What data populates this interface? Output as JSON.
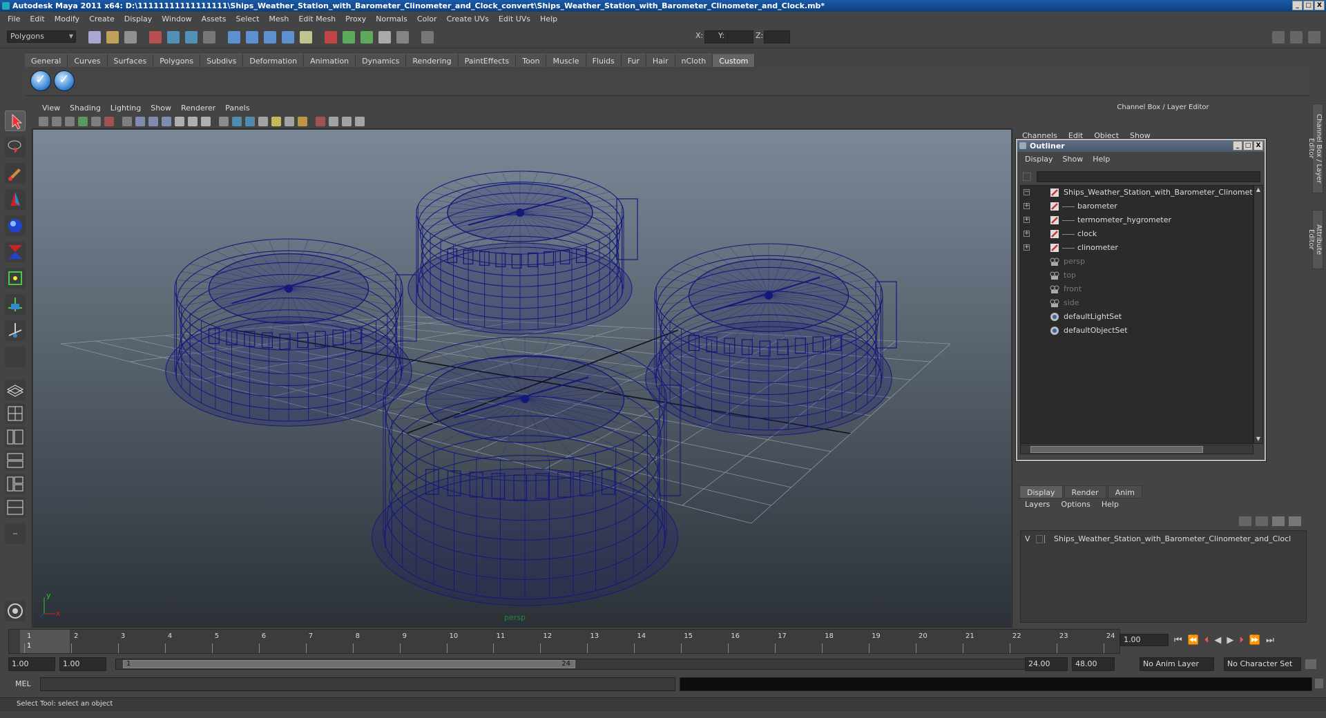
{
  "window": {
    "title": "Autodesk Maya 2011 x64: D:\\11111111111111111\\Ships_Weather_Station_with_Barometer_Clinometer_and_Clock_convert\\Ships_Weather_Station_with_Barometer_Clinometer_and_Clock.mb*",
    "min": "_",
    "max": "□",
    "close": "X"
  },
  "menubar": [
    "File",
    "Edit",
    "Modify",
    "Create",
    "Display",
    "Window",
    "Assets",
    "Select",
    "Mesh",
    "Edit Mesh",
    "Proxy",
    "Normals",
    "Color",
    "Create UVs",
    "Edit UVs",
    "Help"
  ],
  "statusline": {
    "mode": "Polygons",
    "x_label": "X:",
    "y_label": "Y:",
    "z_label": "Z:"
  },
  "shelf": {
    "tabs": [
      "General",
      "Curves",
      "Surfaces",
      "Polygons",
      "Subdivs",
      "Deformation",
      "Animation",
      "Dynamics",
      "Rendering",
      "PaintEffects",
      "Toon",
      "Muscle",
      "Fluids",
      "Fur",
      "Hair",
      "nCloth",
      "Custom"
    ],
    "active_tab": "Custom"
  },
  "viewport": {
    "menu": [
      "View",
      "Shading",
      "Lighting",
      "Show",
      "Renderer",
      "Panels"
    ],
    "camera": "persp",
    "axis_x": "x",
    "axis_y": "y",
    "wire_color": "#151a7a"
  },
  "channel_box": {
    "title": "Channel Box / Layer Editor",
    "menu": [
      "Channels",
      "Edit",
      "Object",
      "Show"
    ],
    "side_tabs": [
      "Channel Box / Layer Editor",
      "Attribute Editor"
    ]
  },
  "outliner": {
    "title": "Outliner",
    "menu": [
      "Display",
      "Show",
      "Help"
    ],
    "items": [
      {
        "label": "Ships_Weather_Station_with_Barometer_Clinometer_a",
        "type": "group",
        "indent": 0,
        "expander": "−",
        "dim": false
      },
      {
        "label": "barometer",
        "type": "group",
        "indent": 1,
        "expander": "+",
        "dim": false
      },
      {
        "label": "termometer_hygrometer",
        "type": "group",
        "indent": 1,
        "expander": "+",
        "dim": false
      },
      {
        "label": "clock",
        "type": "group",
        "indent": 1,
        "expander": "+",
        "dim": false
      },
      {
        "label": "clinometer",
        "type": "group",
        "indent": 1,
        "expander": "+",
        "dim": false
      },
      {
        "label": "persp",
        "type": "camera",
        "indent": 0,
        "expander": "",
        "dim": true
      },
      {
        "label": "top",
        "type": "camera",
        "indent": 0,
        "expander": "",
        "dim": true
      },
      {
        "label": "front",
        "type": "camera",
        "indent": 0,
        "expander": "",
        "dim": true
      },
      {
        "label": "side",
        "type": "camera",
        "indent": 0,
        "expander": "",
        "dim": true
      },
      {
        "label": "defaultLightSet",
        "type": "set",
        "indent": 0,
        "expander": "",
        "dim": false
      },
      {
        "label": "defaultObjectSet",
        "type": "set",
        "indent": 0,
        "expander": "",
        "dim": false
      }
    ]
  },
  "layer_editor": {
    "tabs": [
      "Display",
      "Render",
      "Anim"
    ],
    "active_tab": "Display",
    "menu": [
      "Layers",
      "Options",
      "Help"
    ],
    "layer": {
      "visible": "V",
      "name": "Ships_Weather_Station_with_Barometer_Clinometer_and_Clocl"
    }
  },
  "timeline": {
    "ticks": [
      "1",
      "2",
      "3",
      "4",
      "5",
      "6",
      "7",
      "8",
      "9",
      "10",
      "11",
      "12",
      "13",
      "14",
      "15",
      "16",
      "17",
      "18",
      "19",
      "20",
      "21",
      "22",
      "23",
      "24"
    ],
    "current_frame": "1.00",
    "playhead_label": "1"
  },
  "range": {
    "start": "1.00",
    "range_start": "1.00",
    "slider_start": "1",
    "slider_end": "24",
    "range_end": "24.00",
    "end": "48.00",
    "anim_layer": "No Anim Layer",
    "character_set": "No Character Set"
  },
  "command": {
    "label": "MEL"
  },
  "help": {
    "text": "Select Tool: select an object"
  }
}
